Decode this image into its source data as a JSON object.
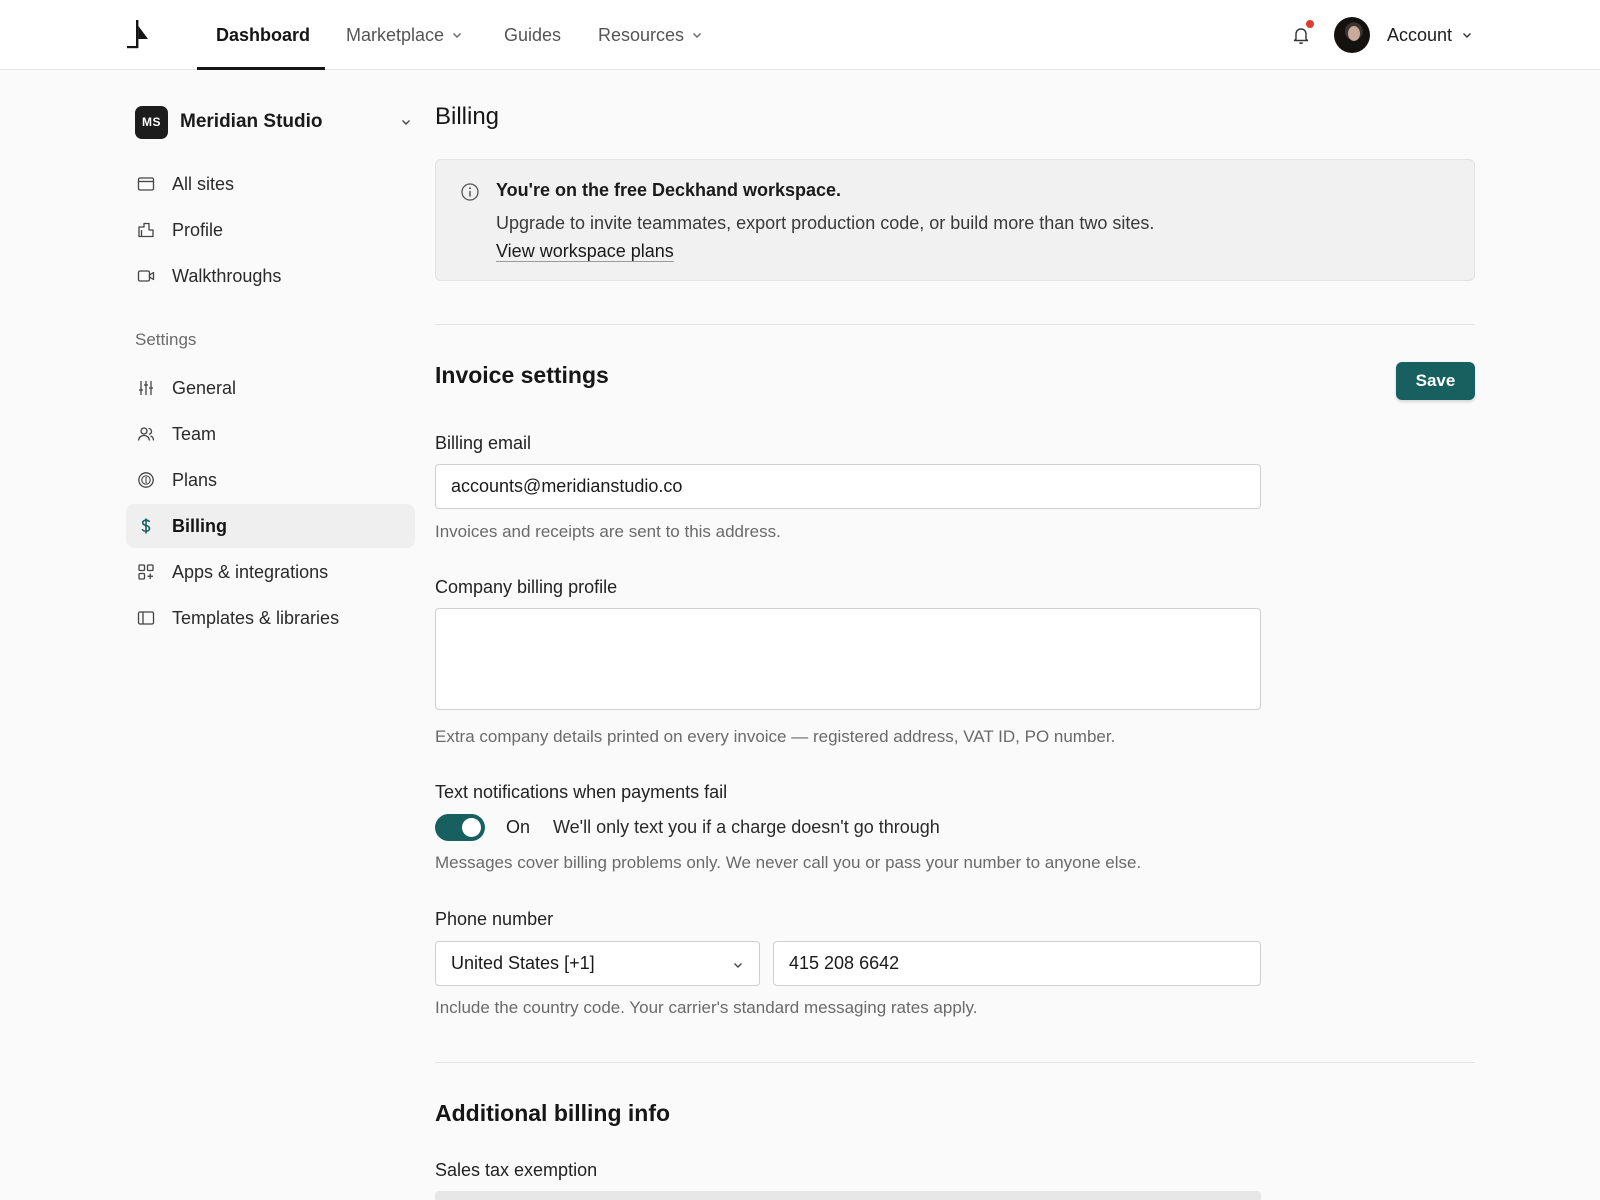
{
  "topnav": {
    "items": [
      {
        "label": "Dashboard",
        "active": true
      },
      {
        "label": "Marketplace",
        "has_dropdown": true
      },
      {
        "label": "Guides"
      },
      {
        "label": "Resources",
        "has_dropdown": true
      }
    ],
    "account_label": "Account",
    "notification_dot_color": "#e03b2f"
  },
  "sidebar": {
    "workspace": {
      "initials": "MS",
      "name": "Meridian Studio"
    },
    "primary_items": [
      {
        "label": "All sites",
        "icon": "browser-window-icon"
      },
      {
        "label": "Profile",
        "icon": "storefront-icon"
      },
      {
        "label": "Walkthroughs",
        "icon": "video-camera-icon"
      }
    ],
    "settings_heading": "Settings",
    "settings_items": [
      {
        "label": "General",
        "icon": "sliders-icon"
      },
      {
        "label": "Team",
        "icon": "users-icon"
      },
      {
        "label": "Plans",
        "icon": "coin-icon"
      },
      {
        "label": "Billing",
        "icon": "dollar-icon",
        "active": true
      },
      {
        "label": "Apps & integrations",
        "icon": "apps-grid-icon"
      },
      {
        "label": "Templates & libraries",
        "icon": "sidebar-panel-icon"
      }
    ]
  },
  "main": {
    "page_title": "Billing",
    "banner": {
      "title": "You're on the free Deckhand workspace.",
      "text": "Upgrade to invite teammates, export production code, or build more than two sites.",
      "link": "View workspace plans"
    },
    "invoice_settings": {
      "title": "Invoice settings",
      "save_label": "Save",
      "billing_email": {
        "label": "Billing email",
        "value": "accounts@meridianstudio.co",
        "help": "Invoices and receipts are sent to this address."
      },
      "company_profile": {
        "label": "Company billing profile",
        "value": "",
        "help": "Extra company details printed on every invoice — registered address, VAT ID, PO number."
      },
      "text_notifications": {
        "label": "Text notifications when payments fail",
        "enabled": true,
        "state_label": "On",
        "description": "We'll only text you if a charge doesn't go through",
        "help": "Messages cover billing problems only. We never call you or pass your number to anyone else."
      },
      "phone": {
        "label": "Phone number",
        "country": "United States [+1]",
        "number": "415 208 6642",
        "help": "Include the country code. Your carrier's standard messaging rates apply."
      }
    },
    "additional": {
      "title": "Additional billing info",
      "sales_tax_label": "Sales tax exemption"
    }
  },
  "colors": {
    "accent": "#17605f",
    "page_bg": "#fafafa",
    "banner_bg": "#f1f1f1"
  }
}
